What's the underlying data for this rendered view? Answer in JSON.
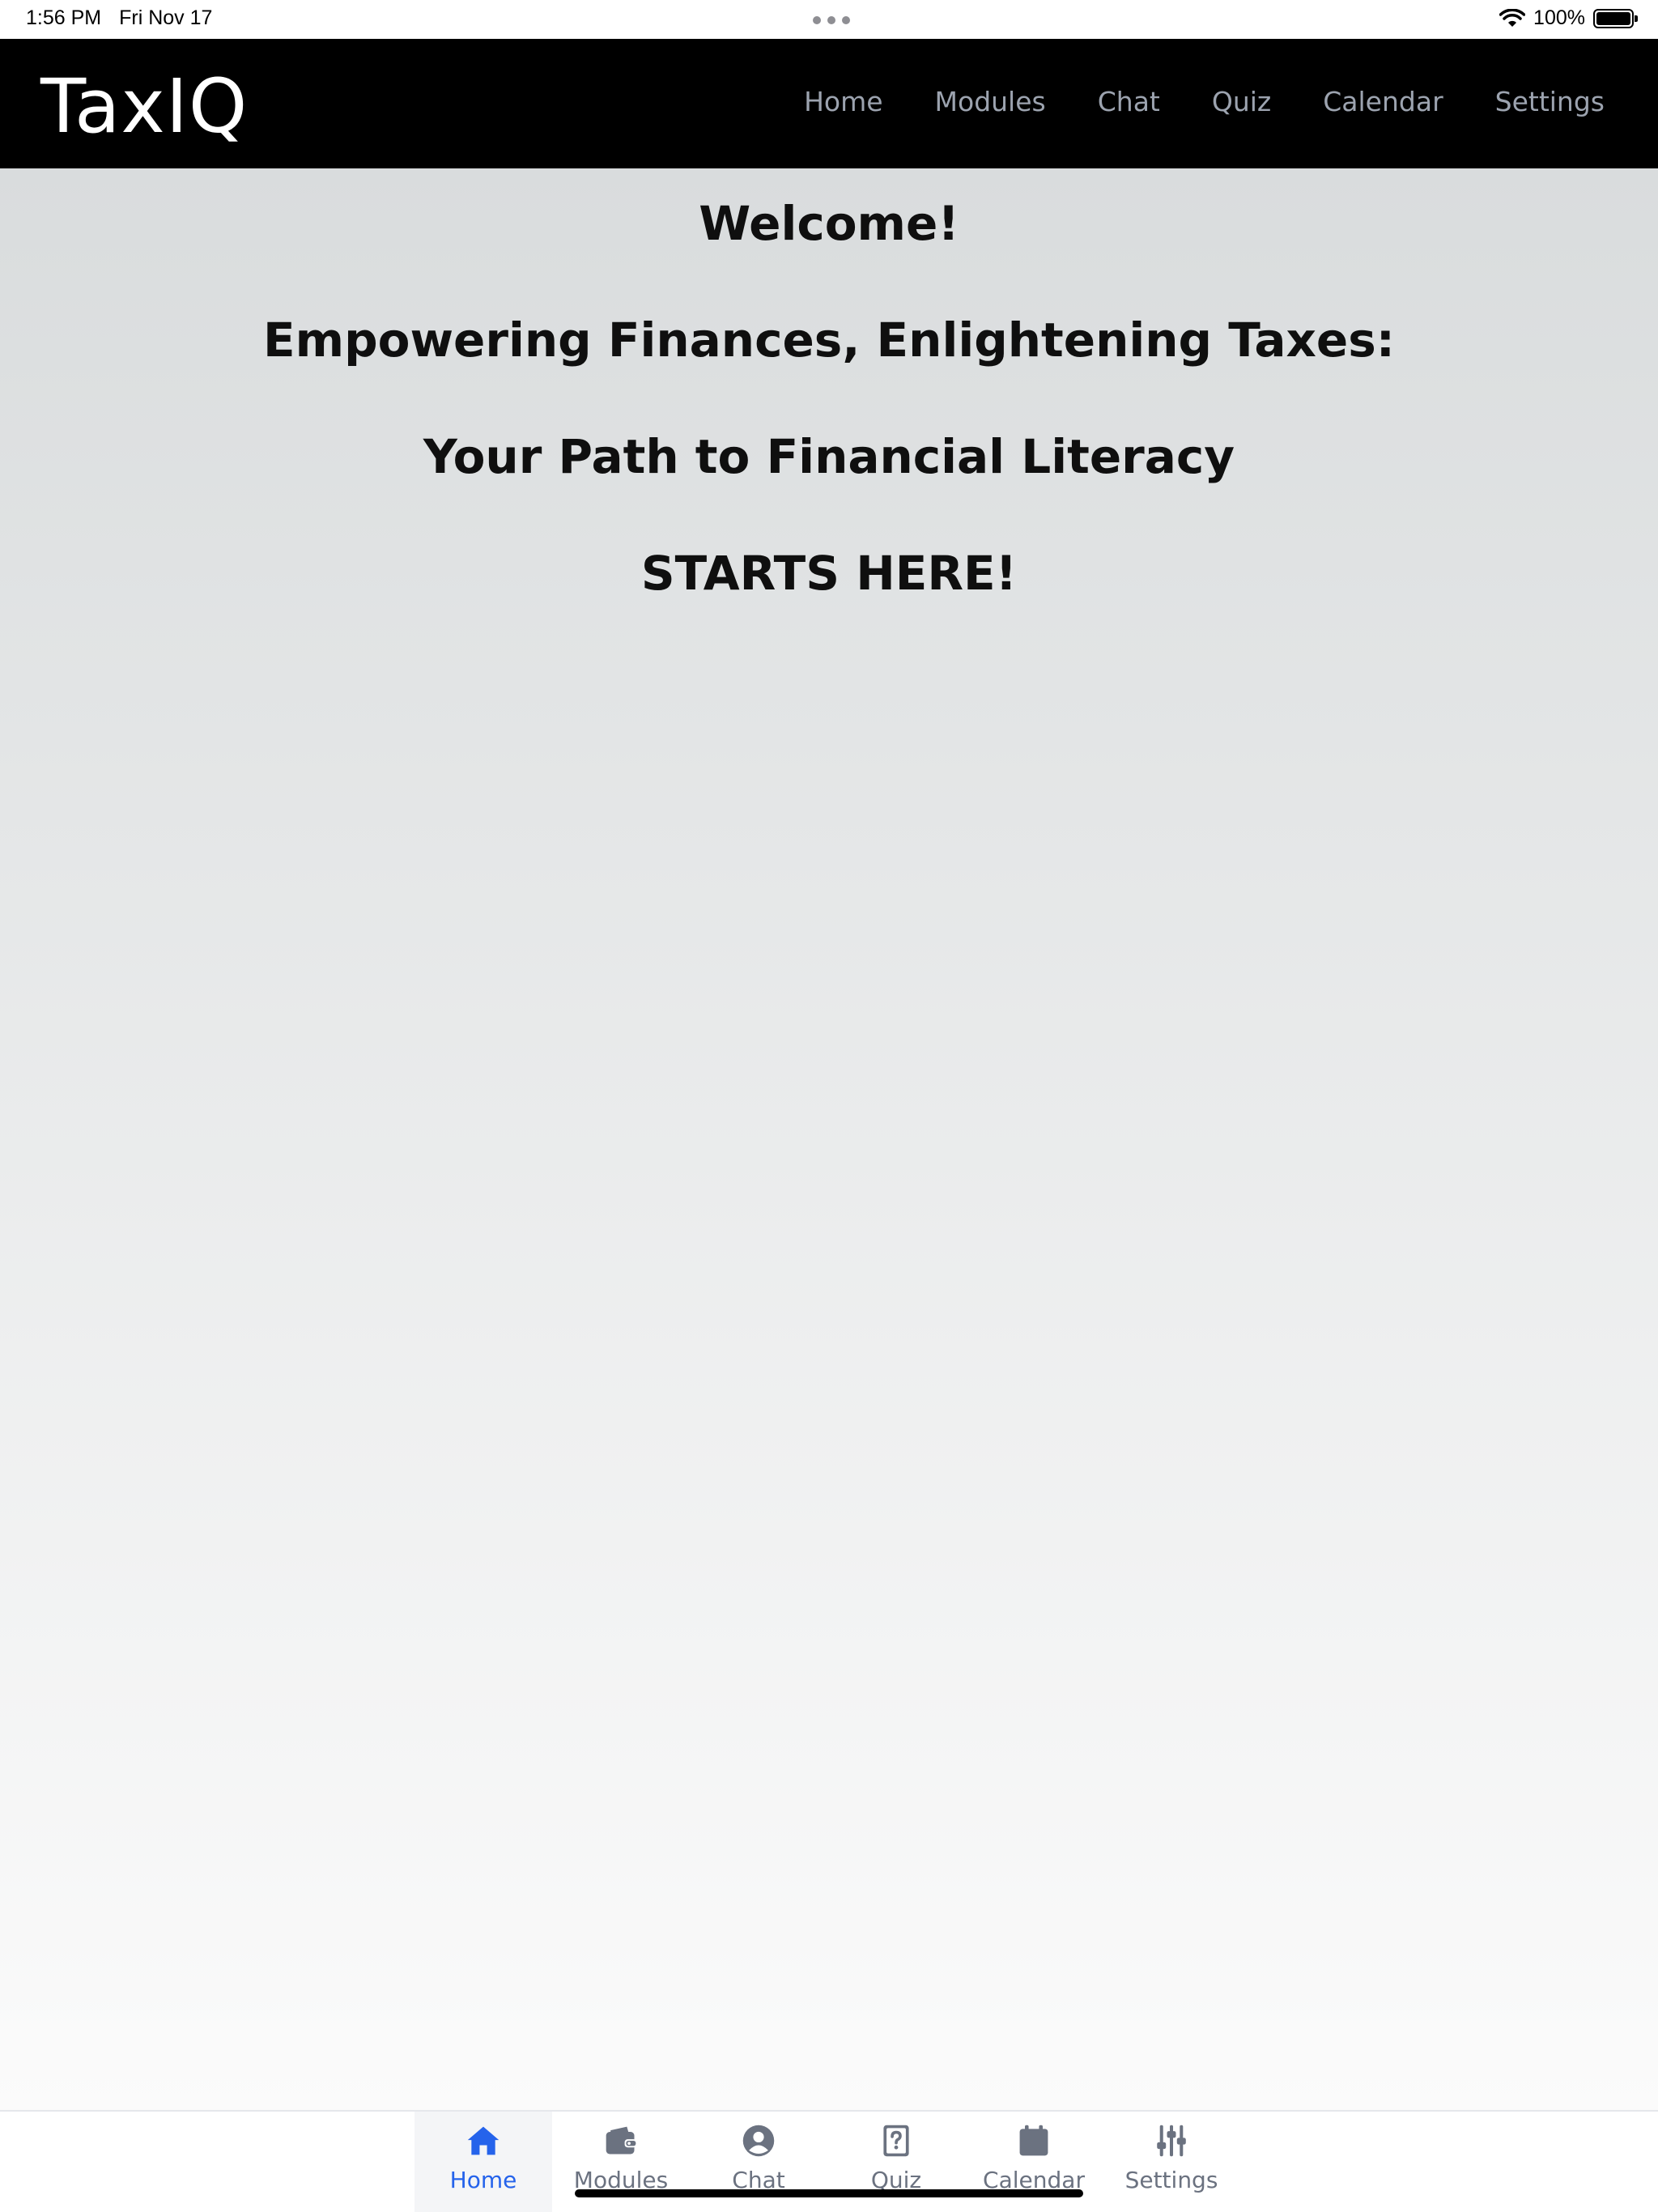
{
  "status_bar": {
    "time": "1:56 PM",
    "date": "Fri Nov 17",
    "battery": "100%",
    "battery_level": 1.0
  },
  "header": {
    "brand": "TaxIQ",
    "nav": [
      "Home",
      "Modules",
      "Chat",
      "Quiz",
      "Calendar",
      "Settings"
    ]
  },
  "hero": {
    "line1": "Welcome!",
    "line2": "Empowering Finances, Enlightening Taxes:",
    "line3": "Your Path to Financial Literacy",
    "line4": "STARTS HERE!"
  },
  "tab_bar": {
    "active_tab": "Home",
    "tabs": [
      {
        "label": "Home",
        "icon": "home-icon"
      },
      {
        "label": "Modules",
        "icon": "wallet-icon"
      },
      {
        "label": "Chat",
        "icon": "user-circle-icon"
      },
      {
        "label": "Quiz",
        "icon": "question-icon"
      },
      {
        "label": "Calendar",
        "icon": "calendar-icon"
      },
      {
        "label": "Settings",
        "icon": "sliders-icon"
      }
    ]
  },
  "colors": {
    "header_bg": "#000000",
    "nav_text": "#9ca3af",
    "active_tab": "#2563eb",
    "inactive_tab": "#6b7280"
  }
}
